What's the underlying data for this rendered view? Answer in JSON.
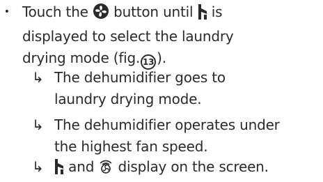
{
  "step": {
    "line1_a": "Touch the",
    "line1_b": "button until",
    "line1_c": "is",
    "line2": "displayed to select the laundry",
    "line3_a": "drying mode (fig.",
    "fig_number": "13",
    "line3_b": ")."
  },
  "results": [
    {
      "arrow": "↳",
      "line1": "The dehumidifier goes to",
      "line2": "laundry drying mode."
    },
    {
      "arrow": "↳",
      "line1": "The dehumidifier operates under",
      "line2": "the highest fan speed."
    },
    {
      "arrow": "↳",
      "text_a": "and",
      "text_b": "display on the screen."
    }
  ],
  "icons": {
    "fan_button": "fan-button-icon",
    "laundry_mode": "laundry-mode-icon",
    "high_fan": "high-fan-speed-icon"
  }
}
